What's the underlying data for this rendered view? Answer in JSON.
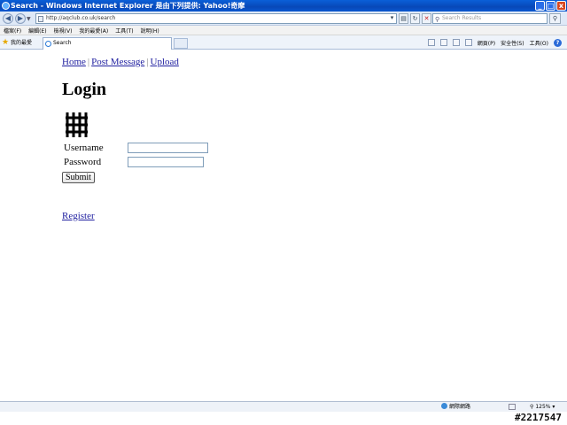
{
  "window": {
    "title": "Search - Windows Internet Explorer 是由下列提供: Yahoo!奇摩",
    "buttons": {
      "minimize": "_",
      "maximize": "□",
      "close": "x"
    }
  },
  "addressbar": {
    "url": "http://aqclub.co.uk/search",
    "search_placeholder": "Search Results"
  },
  "menu": {
    "items": [
      "檔案(F)",
      "編輯(E)",
      "檢視(V)",
      "我的最愛(A)",
      "工具(T)",
      "說明(H)"
    ]
  },
  "tabbar": {
    "favorites_label": "我的最愛",
    "tab_title": "Search",
    "tools": {
      "page": "網頁(P)",
      "safety": "安全性(S)",
      "tools": "工具(O)",
      "help": "?"
    }
  },
  "page": {
    "nav": {
      "home": "Home",
      "post_message": "Post Message",
      "upload": "Upload",
      "separator": "|"
    },
    "heading": "Login",
    "form": {
      "username_label": "Username",
      "password_label": "Password",
      "username_value": "",
      "password_value": "",
      "submit_label": "Submit"
    },
    "register_link": "Register"
  },
  "statusbar": {
    "zone": "網際網路",
    "zoom": "125%"
  },
  "watermark": "#2217547"
}
